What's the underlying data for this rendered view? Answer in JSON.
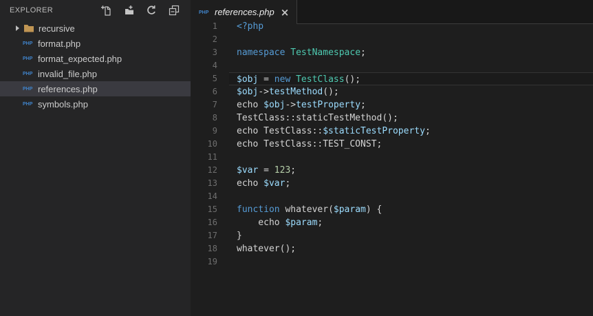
{
  "colors": {
    "editorBg": "#1E1E1E",
    "sidebarBg": "#252526",
    "selectionBg": "#3A3A40",
    "kw": "#569CD6",
    "cl": "#4EC9B0",
    "var": "#9CDCFE",
    "num": "#B5CEA8",
    "df": "#D4D4D4",
    "lineNo": "#6E6E6E",
    "phpBlue": "#4083C9",
    "folder": "#C09553",
    "icon": "#C5C5C5",
    "tabText": "#ECECEC",
    "headerText": "#BBBBBB",
    "lineHi": "#343434",
    "tabRestBg": "#181818",
    "tabBorder": "#3C3C3C"
  },
  "sidebar": {
    "title": "EXPLORER",
    "actions": [
      {
        "name": "new-file-icon",
        "label": "New File"
      },
      {
        "name": "new-folder-icon",
        "label": "New Folder"
      },
      {
        "name": "refresh-icon",
        "label": "Refresh"
      },
      {
        "name": "collapse-all-icon",
        "label": "Collapse All"
      }
    ],
    "tree": [
      {
        "type": "folder",
        "label": "recursive",
        "expanded": false,
        "selected": false
      },
      {
        "type": "file",
        "label": "format.php",
        "icon": "PHP",
        "selected": false
      },
      {
        "type": "file",
        "label": "format_expected.php",
        "icon": "PHP",
        "selected": false
      },
      {
        "type": "file",
        "label": "invalid_file.php",
        "icon": "PHP",
        "selected": false
      },
      {
        "type": "file",
        "label": "references.php",
        "icon": "PHP",
        "selected": true
      },
      {
        "type": "file",
        "label": "symbols.php",
        "icon": "PHP",
        "selected": false
      }
    ]
  },
  "editor": {
    "tab": {
      "label": "references.php",
      "icon": "PHP",
      "close_glyph": "×",
      "preview": true,
      "active": true
    },
    "lines": [
      {
        "no": "1",
        "tokens": [
          {
            "t": "<?php",
            "c": "kw"
          }
        ]
      },
      {
        "no": "2",
        "tokens": []
      },
      {
        "no": "3",
        "tokens": [
          {
            "t": "namespace",
            "c": "kw"
          },
          {
            "t": " ",
            "c": "df"
          },
          {
            "t": "TestNamespace",
            "c": "cl"
          },
          {
            "t": ";",
            "c": "df"
          }
        ]
      },
      {
        "no": "4",
        "tokens": []
      },
      {
        "no": "5",
        "current": true,
        "tokens": [
          {
            "t": "$obj",
            "c": "var"
          },
          {
            "t": " = ",
            "c": "df"
          },
          {
            "t": "new",
            "c": "kw"
          },
          {
            "t": " ",
            "c": "df"
          },
          {
            "t": "TestClass",
            "c": "cl"
          },
          {
            "t": "();",
            "c": "df"
          }
        ]
      },
      {
        "no": "6",
        "tokens": [
          {
            "t": "$obj",
            "c": "var"
          },
          {
            "t": "->",
            "c": "df"
          },
          {
            "t": "testMethod",
            "c": "var"
          },
          {
            "t": "();",
            "c": "df"
          }
        ]
      },
      {
        "no": "7",
        "tokens": [
          {
            "t": "echo ",
            "c": "df"
          },
          {
            "t": "$obj",
            "c": "var"
          },
          {
            "t": "->",
            "c": "df"
          },
          {
            "t": "testProperty",
            "c": "var"
          },
          {
            "t": ";",
            "c": "df"
          }
        ]
      },
      {
        "no": "8",
        "tokens": [
          {
            "t": "TestClass::staticTestMethod();",
            "c": "df"
          }
        ]
      },
      {
        "no": "9",
        "tokens": [
          {
            "t": "echo TestClass::",
            "c": "df"
          },
          {
            "t": "$staticTestProperty",
            "c": "var"
          },
          {
            "t": ";",
            "c": "df"
          }
        ]
      },
      {
        "no": "10",
        "tokens": [
          {
            "t": "echo TestClass::TEST_CONST;",
            "c": "df"
          }
        ]
      },
      {
        "no": "11",
        "tokens": []
      },
      {
        "no": "12",
        "tokens": [
          {
            "t": "$var",
            "c": "var"
          },
          {
            "t": " = ",
            "c": "df"
          },
          {
            "t": "123",
            "c": "num"
          },
          {
            "t": ";",
            "c": "df"
          }
        ]
      },
      {
        "no": "13",
        "tokens": [
          {
            "t": "echo ",
            "c": "df"
          },
          {
            "t": "$var",
            "c": "var"
          },
          {
            "t": ";",
            "c": "df"
          }
        ]
      },
      {
        "no": "14",
        "tokens": []
      },
      {
        "no": "15",
        "tokens": [
          {
            "t": "function",
            "c": "kw"
          },
          {
            "t": " whatever(",
            "c": "df"
          },
          {
            "t": "$param",
            "c": "var"
          },
          {
            "t": ") {",
            "c": "df"
          }
        ]
      },
      {
        "no": "16",
        "tokens": [
          {
            "t": "    echo ",
            "c": "df"
          },
          {
            "t": "$param",
            "c": "var"
          },
          {
            "t": ";",
            "c": "df"
          }
        ]
      },
      {
        "no": "17",
        "tokens": [
          {
            "t": "}",
            "c": "df"
          }
        ]
      },
      {
        "no": "18",
        "tokens": [
          {
            "t": "whatever();",
            "c": "df"
          }
        ]
      },
      {
        "no": "19",
        "tokens": []
      }
    ]
  }
}
